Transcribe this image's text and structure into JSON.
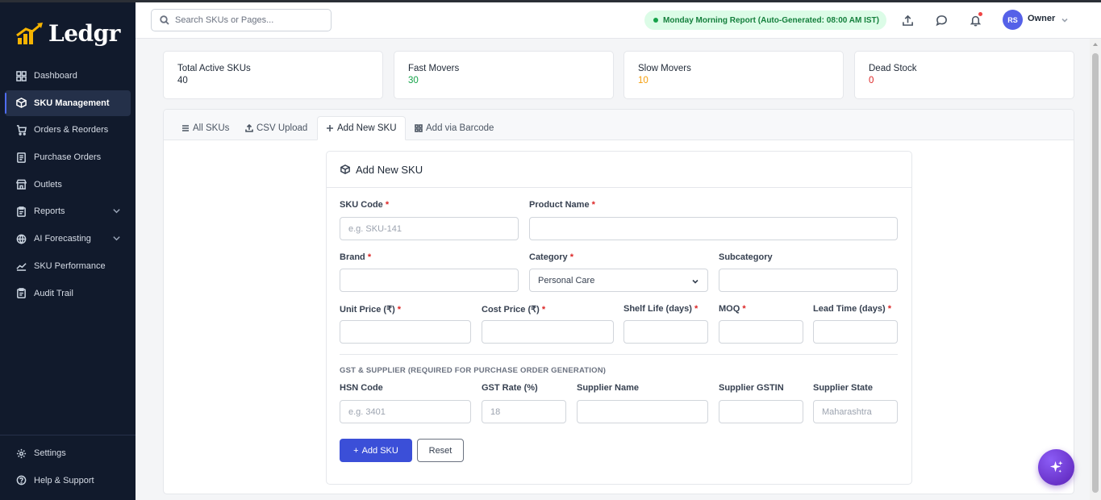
{
  "brand": {
    "name": "Ledgr"
  },
  "sidebar": {
    "items": [
      {
        "label": "Dashboard",
        "icon": "grid-icon"
      },
      {
        "label": "SKU Management",
        "icon": "box-icon",
        "active": true
      },
      {
        "label": "Orders & Reorders",
        "icon": "cart-icon"
      },
      {
        "label": "Purchase Orders",
        "icon": "document-icon"
      },
      {
        "label": "Outlets",
        "icon": "store-icon"
      },
      {
        "label": "Reports",
        "icon": "clipboard-icon",
        "expandable": true
      },
      {
        "label": "AI Forecasting",
        "icon": "globe-icon",
        "expandable": true
      },
      {
        "label": "SKU Performance",
        "icon": "trend-icon"
      },
      {
        "label": "Audit Trail",
        "icon": "clipboard-icon"
      }
    ],
    "bottom": [
      {
        "label": "Settings",
        "icon": "gear-icon"
      },
      {
        "label": "Help & Support",
        "icon": "help-icon"
      }
    ]
  },
  "topbar": {
    "search_placeholder": "Search SKUs or Pages...",
    "report_text": "Monday Morning Report (Auto-Generated: 08:00 AM IST)",
    "avatar_initials": "RS",
    "user_role": "Owner"
  },
  "stats": [
    {
      "title": "Total Active SKUs",
      "value": "40",
      "color": "#1f2937"
    },
    {
      "title": "Fast Movers",
      "value": "30",
      "color": "#16a34a"
    },
    {
      "title": "Slow Movers",
      "value": "10",
      "color": "#f59e0b"
    },
    {
      "title": "Dead Stock",
      "value": "0",
      "color": "#dc2626"
    }
  ],
  "tabs": [
    {
      "label": "All SKUs"
    },
    {
      "label": "CSV Upload"
    },
    {
      "label": "Add New SKU",
      "active": true
    },
    {
      "label": "Add via Barcode"
    }
  ],
  "form": {
    "title": "Add New SKU",
    "required_mark": "*",
    "fields": {
      "sku_code": {
        "label": "SKU Code",
        "placeholder": "e.g. SKU-141",
        "value": ""
      },
      "product_name": {
        "label": "Product Name",
        "placeholder": "",
        "value": ""
      },
      "brand": {
        "label": "Brand",
        "value": ""
      },
      "category": {
        "label": "Category",
        "value": "Personal Care"
      },
      "subcategory": {
        "label": "Subcategory",
        "value": ""
      },
      "unit_price": {
        "label": "Unit Price (₹)",
        "value": ""
      },
      "cost_price": {
        "label": "Cost Price (₹)",
        "value": ""
      },
      "shelf_life": {
        "label": "Shelf Life (days)",
        "value": ""
      },
      "moq": {
        "label": "MOQ",
        "value": ""
      },
      "lead_time": {
        "label": "Lead Time (days)",
        "value": ""
      },
      "hsn_code": {
        "label": "HSN Code",
        "placeholder": "e.g. 3401",
        "value": ""
      },
      "gst_rate": {
        "label": "GST Rate (%)",
        "placeholder": "18",
        "value": ""
      },
      "supplier_name": {
        "label": "Supplier Name",
        "value": ""
      },
      "supplier_gstin": {
        "label": "Supplier GSTIN",
        "value": ""
      },
      "supplier_state": {
        "label": "Supplier State",
        "placeholder": "Maharashtra",
        "value": ""
      }
    },
    "section_title": "GST & SUPPLIER (REQUIRED FOR PURCHASE ORDER GENERATION)",
    "submit_label": "Add SKU",
    "reset_label": "Reset"
  },
  "colors": {
    "accent": "#3b4fd8",
    "sidebar_bg": "#111a2c",
    "required": "#dc2626",
    "report_pill": "#dcfce7"
  }
}
